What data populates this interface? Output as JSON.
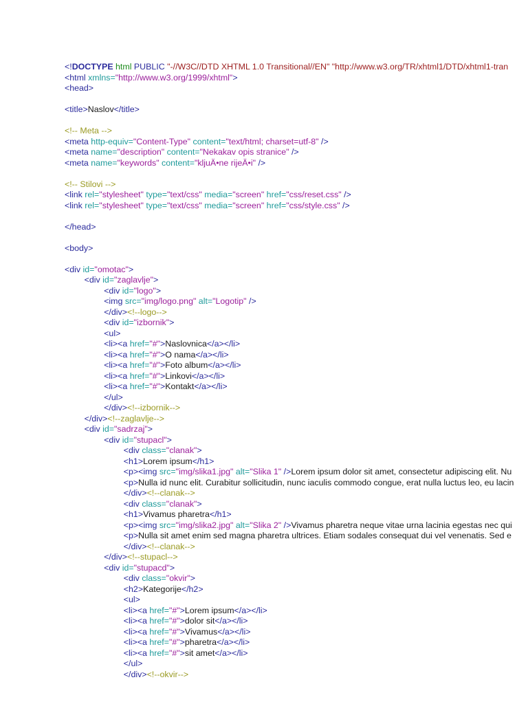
{
  "document": {
    "lines": [
      {
        "i": 0,
        "t": [
          [
            "t",
            "<!"
          ],
          [
            "k",
            "DOCTYPE"
          ],
          [
            "g",
            " html"
          ],
          [
            "t",
            " PUBLIC"
          ],
          [
            "s",
            " \"-//W3C//DTD XHTML 1.0 Transitional//EN\" \"http://www.w3.org/TR/xhtml1/DTD/xhtml1-tran"
          ]
        ]
      },
      {
        "i": 0,
        "t": [
          [
            "t",
            "<html "
          ],
          [
            "a",
            "xmlns="
          ],
          [
            "v",
            "\"http://www.w3.org/1999/xhtml\""
          ],
          [
            "t",
            ">"
          ]
        ]
      },
      {
        "i": 0,
        "t": [
          [
            "t",
            "<head>"
          ]
        ]
      },
      {
        "i": 0,
        "t": []
      },
      {
        "i": 0,
        "t": [
          [
            "t",
            "<title>"
          ],
          [
            "x",
            "Naslov"
          ],
          [
            "t",
            "</title>"
          ]
        ]
      },
      {
        "i": 0,
        "t": []
      },
      {
        "i": 0,
        "t": [
          [
            "c",
            "<!-- Meta -->"
          ]
        ]
      },
      {
        "i": 0,
        "t": [
          [
            "t",
            "<meta "
          ],
          [
            "a",
            "http-equiv="
          ],
          [
            "v",
            "\"Content-Type\""
          ],
          [
            "a",
            " content="
          ],
          [
            "v",
            "\"text/html; charset=utf-8\""
          ],
          [
            "t",
            " />"
          ]
        ]
      },
      {
        "i": 0,
        "t": [
          [
            "t",
            "<meta "
          ],
          [
            "a",
            "name="
          ],
          [
            "v",
            "\"description\""
          ],
          [
            "a",
            " content="
          ],
          [
            "v",
            "\"Nekakav opis stranice\""
          ],
          [
            "t",
            " />"
          ]
        ]
      },
      {
        "i": 0,
        "t": [
          [
            "t",
            "<meta "
          ],
          [
            "a",
            "name="
          ],
          [
            "v",
            "\"keywords\""
          ],
          [
            "a",
            " content="
          ],
          [
            "v",
            "\"kljuÄ•ne rijeÄ•i\""
          ],
          [
            "t",
            " />"
          ]
        ]
      },
      {
        "i": 0,
        "t": []
      },
      {
        "i": 0,
        "t": [
          [
            "c",
            "<!-- Stilovi -->"
          ]
        ]
      },
      {
        "i": 0,
        "t": [
          [
            "t",
            "<link "
          ],
          [
            "a",
            "rel="
          ],
          [
            "v",
            "\"stylesheet\""
          ],
          [
            "a",
            " type="
          ],
          [
            "v",
            "\"text/css\""
          ],
          [
            "a",
            " media="
          ],
          [
            "v",
            "\"screen\""
          ],
          [
            "a",
            " href="
          ],
          [
            "v",
            "\"css/reset.css\""
          ],
          [
            "t",
            " />"
          ]
        ]
      },
      {
        "i": 0,
        "t": [
          [
            "t",
            "<link "
          ],
          [
            "a",
            "rel="
          ],
          [
            "v",
            "\"stylesheet\""
          ],
          [
            "a",
            " type="
          ],
          [
            "v",
            "\"text/css\""
          ],
          [
            "a",
            " media="
          ],
          [
            "v",
            "\"screen\""
          ],
          [
            "a",
            " href="
          ],
          [
            "v",
            "\"css/style.css\""
          ],
          [
            "t",
            " />"
          ]
        ]
      },
      {
        "i": 0,
        "t": []
      },
      {
        "i": 0,
        "t": [
          [
            "t",
            "</head>"
          ]
        ]
      },
      {
        "i": 0,
        "t": []
      },
      {
        "i": 0,
        "t": [
          [
            "t",
            "<body>"
          ]
        ]
      },
      {
        "i": 0,
        "t": []
      },
      {
        "i": 0,
        "t": [
          [
            "t",
            "<div "
          ],
          [
            "a",
            "id="
          ],
          [
            "v",
            "\"omotac\""
          ],
          [
            "t",
            ">"
          ]
        ]
      },
      {
        "i": 1,
        "t": [
          [
            "t",
            "<div "
          ],
          [
            "a",
            "id="
          ],
          [
            "v",
            "\"zaglavlje\""
          ],
          [
            "t",
            ">"
          ]
        ]
      },
      {
        "i": 2,
        "t": [
          [
            "t",
            "<div "
          ],
          [
            "a",
            "id="
          ],
          [
            "v",
            "\"logo\""
          ],
          [
            "t",
            ">"
          ]
        ]
      },
      {
        "i": 2,
        "t": [
          [
            "t",
            "<img "
          ],
          [
            "a",
            "src="
          ],
          [
            "v",
            "\"img/logo.png\""
          ],
          [
            "a",
            " alt="
          ],
          [
            "v",
            "\"Logotip\""
          ],
          [
            "t",
            " />"
          ]
        ]
      },
      {
        "i": 2,
        "t": [
          [
            "t",
            "</div>"
          ],
          [
            "c",
            "<!--logo-->"
          ]
        ]
      },
      {
        "i": 2,
        "t": [
          [
            "t",
            "<div "
          ],
          [
            "a",
            "id="
          ],
          [
            "v",
            "\"izbornik\""
          ],
          [
            "t",
            ">"
          ]
        ]
      },
      {
        "i": 2,
        "t": [
          [
            "t",
            "<ul>"
          ]
        ]
      },
      {
        "i": 2,
        "t": [
          [
            "t",
            "<li><a "
          ],
          [
            "a",
            "href="
          ],
          [
            "v",
            "\"#\""
          ],
          [
            "t",
            ">"
          ],
          [
            "x",
            "Naslovnica"
          ],
          [
            "t",
            "</a></li>"
          ]
        ]
      },
      {
        "i": 2,
        "t": [
          [
            "t",
            "<li><a "
          ],
          [
            "a",
            "href="
          ],
          [
            "v",
            "\"#\""
          ],
          [
            "t",
            ">"
          ],
          [
            "x",
            "O nama"
          ],
          [
            "t",
            "</a></li>"
          ]
        ]
      },
      {
        "i": 2,
        "t": [
          [
            "t",
            "<li><a "
          ],
          [
            "a",
            "href="
          ],
          [
            "v",
            "\"#\""
          ],
          [
            "t",
            ">"
          ],
          [
            "x",
            "Foto album"
          ],
          [
            "t",
            "</a></li>"
          ]
        ]
      },
      {
        "i": 2,
        "t": [
          [
            "t",
            "<li><a "
          ],
          [
            "a",
            "href="
          ],
          [
            "v",
            "\"#\""
          ],
          [
            "t",
            ">"
          ],
          [
            "x",
            "Linkovi"
          ],
          [
            "t",
            "</a></li>"
          ]
        ]
      },
      {
        "i": 2,
        "t": [
          [
            "t",
            "<li><a "
          ],
          [
            "a",
            "href="
          ],
          [
            "v",
            "\"#\""
          ],
          [
            "t",
            ">"
          ],
          [
            "x",
            "Kontakt"
          ],
          [
            "t",
            "</a></li>"
          ]
        ]
      },
      {
        "i": 2,
        "t": [
          [
            "t",
            "</ul>"
          ]
        ]
      },
      {
        "i": 2,
        "t": [
          [
            "t",
            "</div>"
          ],
          [
            "c",
            "<!--izbornik-->"
          ]
        ]
      },
      {
        "i": 1,
        "t": [
          [
            "t",
            "</div>"
          ],
          [
            "c",
            "<!--zaglavlje-->"
          ]
        ]
      },
      {
        "i": 1,
        "t": [
          [
            "t",
            "<div "
          ],
          [
            "a",
            "id="
          ],
          [
            "v",
            "\"sadrzaj\""
          ],
          [
            "t",
            ">"
          ]
        ]
      },
      {
        "i": 2,
        "t": [
          [
            "t",
            "<div "
          ],
          [
            "a",
            "id="
          ],
          [
            "v",
            "\"stupacl\""
          ],
          [
            "t",
            ">"
          ]
        ]
      },
      {
        "i": 3,
        "t": [
          [
            "t",
            "<div "
          ],
          [
            "a",
            "class="
          ],
          [
            "v",
            "\"clanak\""
          ],
          [
            "t",
            ">"
          ]
        ]
      },
      {
        "i": 3,
        "t": [
          [
            "t",
            "<h1>"
          ],
          [
            "x",
            "Lorem ipsum"
          ],
          [
            "t",
            "</h1>"
          ]
        ]
      },
      {
        "i": 3,
        "t": [
          [
            "t",
            "<p><img "
          ],
          [
            "a",
            "src="
          ],
          [
            "v",
            "\"img/slika1.jpg\""
          ],
          [
            "a",
            " alt="
          ],
          [
            "v",
            "\"Slika 1\""
          ],
          [
            "t",
            " />"
          ],
          [
            "x",
            "Lorem ipsum dolor sit amet, consectetur adipiscing elit. Nu"
          ]
        ]
      },
      {
        "i": 3,
        "t": [
          [
            "t",
            "<p>"
          ],
          [
            "x",
            "Nulla id nunc elit. Curabitur sollicitudin, nunc iaculis commodo congue, erat nulla luctus leo, eu lacin"
          ]
        ]
      },
      {
        "i": 3,
        "t": [
          [
            "t",
            "</div>"
          ],
          [
            "c",
            "<!--clanak-->"
          ]
        ]
      },
      {
        "i": 3,
        "t": [
          [
            "t",
            "<div "
          ],
          [
            "a",
            "class="
          ],
          [
            "v",
            "\"clanak\""
          ],
          [
            "t",
            ">"
          ]
        ]
      },
      {
        "i": 3,
        "t": [
          [
            "t",
            "<h1>"
          ],
          [
            "x",
            "Vivamus pharetra"
          ],
          [
            "t",
            "</h1>"
          ]
        ]
      },
      {
        "i": 3,
        "t": [
          [
            "t",
            "<p><img "
          ],
          [
            "a",
            "src="
          ],
          [
            "v",
            "\"img/slika2.jpg\""
          ],
          [
            "a",
            " alt="
          ],
          [
            "v",
            "\"Slika 2\""
          ],
          [
            "t",
            " />"
          ],
          [
            "x",
            "Vivamus pharetra neque vitae urna lacinia egestas nec qui"
          ]
        ]
      },
      {
        "i": 3,
        "t": [
          [
            "t",
            "<p>"
          ],
          [
            "x",
            "Nulla sit amet enim sed magna pharetra ultrices. Etiam sodales consequat dui vel venenatis. Sed e"
          ]
        ]
      },
      {
        "i": 3,
        "t": [
          [
            "t",
            "</div>"
          ],
          [
            "c",
            "<!--clanak-->"
          ]
        ]
      },
      {
        "i": 2,
        "t": [
          [
            "t",
            "</div>"
          ],
          [
            "c",
            "<!--stupacl-->"
          ]
        ]
      },
      {
        "i": 2,
        "t": [
          [
            "t",
            "<div "
          ],
          [
            "a",
            "id="
          ],
          [
            "v",
            "\"stupacd\""
          ],
          [
            "t",
            ">"
          ]
        ]
      },
      {
        "i": 3,
        "t": [
          [
            "t",
            "<div "
          ],
          [
            "a",
            "class="
          ],
          [
            "v",
            "\"okvir\""
          ],
          [
            "t",
            ">"
          ]
        ]
      },
      {
        "i": 3,
        "t": [
          [
            "t",
            "<h2>"
          ],
          [
            "x",
            "Kategorije"
          ],
          [
            "t",
            "</h2>"
          ]
        ]
      },
      {
        "i": 3,
        "t": [
          [
            "t",
            "<ul>"
          ]
        ]
      },
      {
        "i": 3,
        "t": [
          [
            "t",
            "<li><a "
          ],
          [
            "a",
            "href="
          ],
          [
            "v",
            "\"#\""
          ],
          [
            "t",
            ">"
          ],
          [
            "x",
            "Lorem ipsum"
          ],
          [
            "t",
            "</a></li>"
          ]
        ]
      },
      {
        "i": 3,
        "t": [
          [
            "t",
            "<li><a "
          ],
          [
            "a",
            "href="
          ],
          [
            "v",
            "\"#\""
          ],
          [
            "t",
            ">"
          ],
          [
            "x",
            "dolor sit"
          ],
          [
            "t",
            "</a></li>"
          ]
        ]
      },
      {
        "i": 3,
        "t": [
          [
            "t",
            "<li><a "
          ],
          [
            "a",
            "href="
          ],
          [
            "v",
            "\"#\""
          ],
          [
            "t",
            ">"
          ],
          [
            "x",
            "Vivamus"
          ],
          [
            "t",
            "</a></li>"
          ]
        ]
      },
      {
        "i": 3,
        "t": [
          [
            "t",
            "<li><a "
          ],
          [
            "a",
            "href="
          ],
          [
            "v",
            "\"#\""
          ],
          [
            "t",
            ">"
          ],
          [
            "x",
            "pharetra"
          ],
          [
            "t",
            "</a></li>"
          ]
        ]
      },
      {
        "i": 3,
        "t": [
          [
            "t",
            "<li><a "
          ],
          [
            "a",
            "href="
          ],
          [
            "v",
            "\"#\""
          ],
          [
            "t",
            ">"
          ],
          [
            "x",
            "sit amet"
          ],
          [
            "t",
            "</a></li>"
          ]
        ]
      },
      {
        "i": 3,
        "t": [
          [
            "t",
            "</ul>"
          ]
        ]
      },
      {
        "i": 3,
        "t": [
          [
            "t",
            "</div>"
          ],
          [
            "c",
            "<!--okvir-->"
          ]
        ]
      }
    ]
  }
}
